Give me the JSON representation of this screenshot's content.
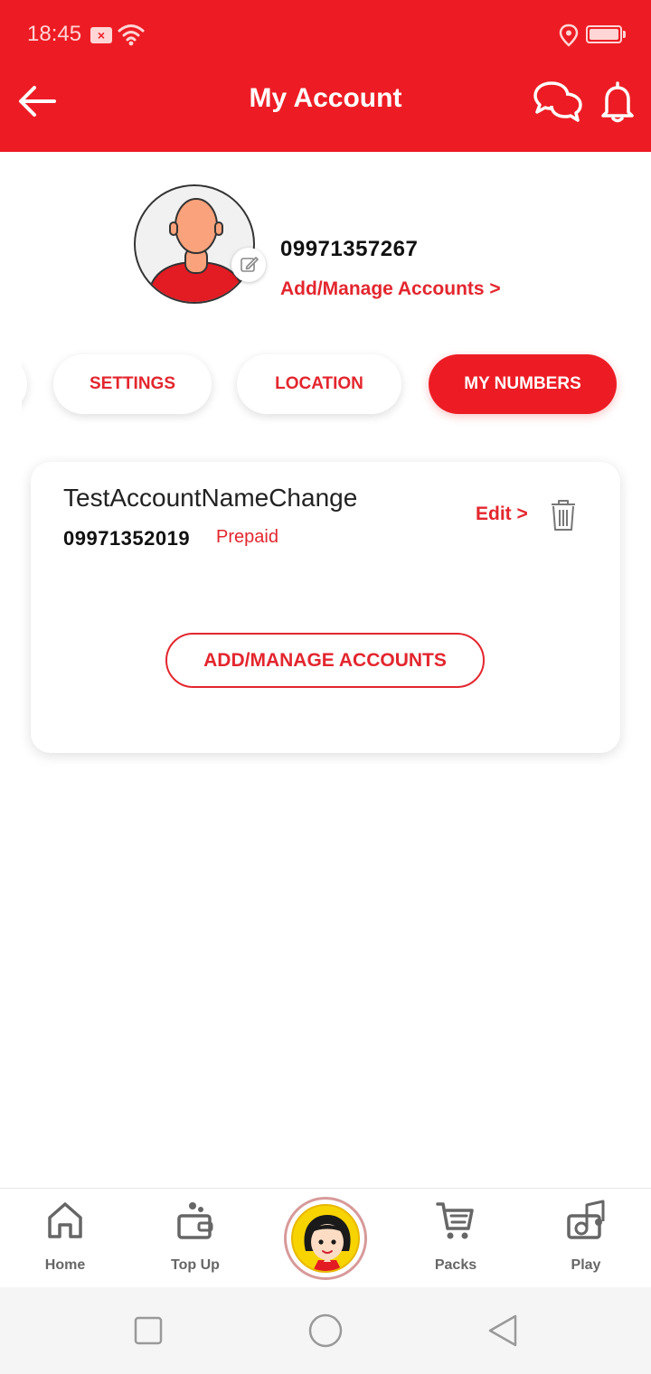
{
  "status_bar": {
    "time": "18:45",
    "icons": [
      "sim-x-icon",
      "wifi-icon",
      "location-icon",
      "battery-icon"
    ]
  },
  "header": {
    "title": "My Account",
    "icons": [
      "back-arrow-icon",
      "chat-icon",
      "bell-icon"
    ]
  },
  "profile": {
    "phone": "09971357267",
    "manage_link": "Add/Manage Accounts >"
  },
  "tabs": [
    {
      "label": "SETTINGS",
      "active": false
    },
    {
      "label": "LOCATION",
      "active": false
    },
    {
      "label": "MY NUMBERS",
      "active": true
    }
  ],
  "account_card": {
    "name": "TestAccountNameChange",
    "number": "09971352019",
    "type": "Prepaid",
    "edit_label": "Edit >",
    "manage_button": "ADD/MANAGE ACCOUNTS"
  },
  "bottom_nav": {
    "items": [
      {
        "label": "Home",
        "icon": "home-icon"
      },
      {
        "label": "Top Up",
        "icon": "wallet-icon"
      },
      {
        "label": "Packs",
        "icon": "cart-icon"
      },
      {
        "label": "Play",
        "icon": "music-icon"
      }
    ],
    "center_icon": "mascot-icon"
  },
  "colors": {
    "brand_red": "#ED1C24",
    "accent_red": "#E3262E",
    "mascot_yellow": "#F7D300"
  }
}
